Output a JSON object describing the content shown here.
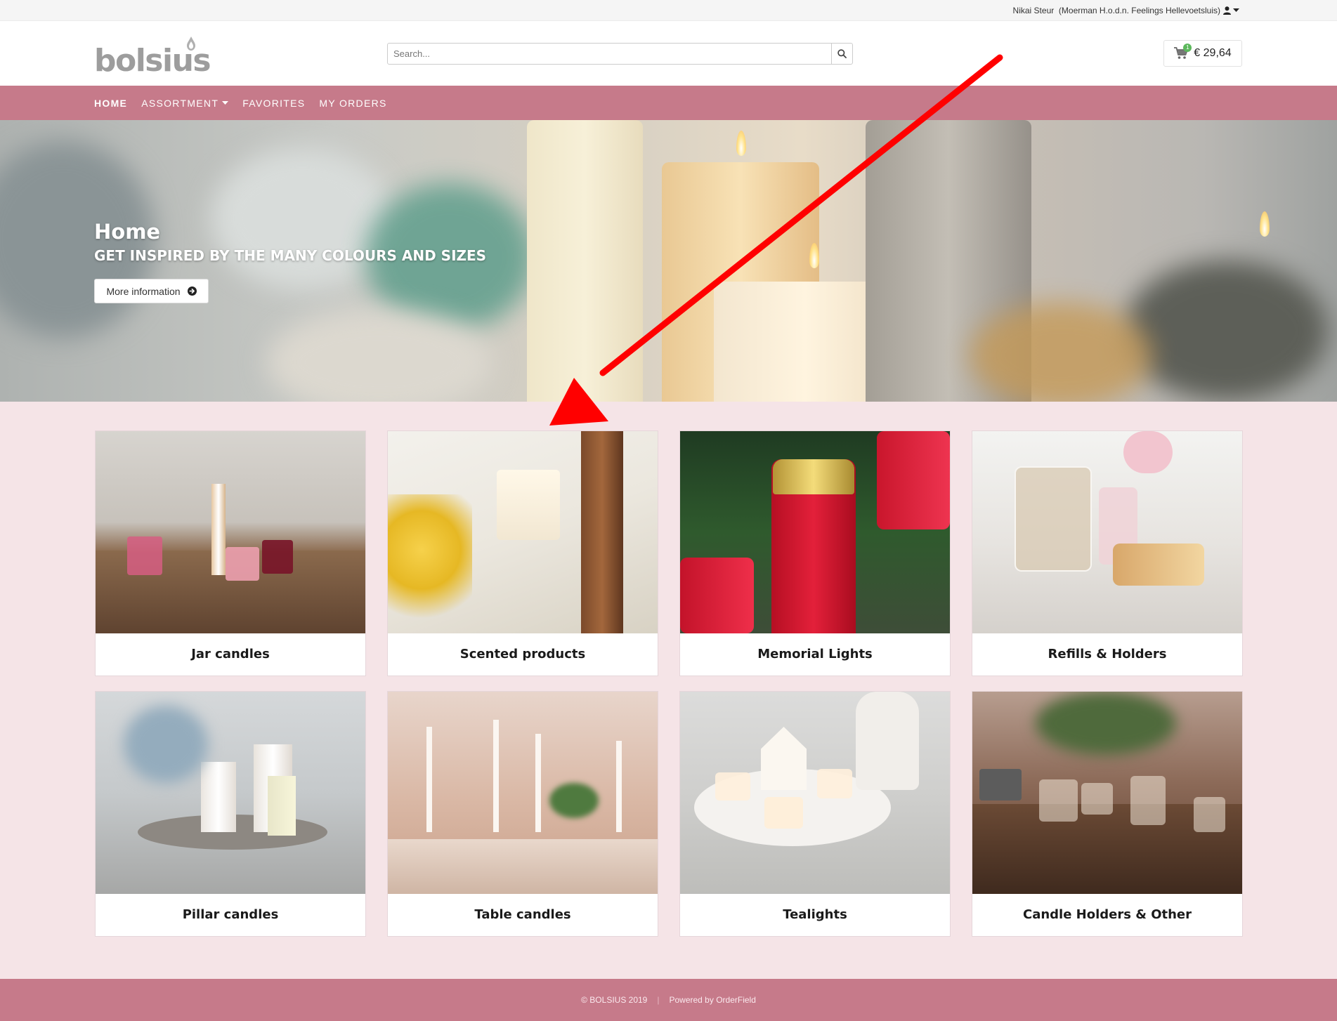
{
  "topbar": {
    "user_name": "Nikai Steur",
    "user_company": "(Moerman H.o.d.n. Feelings Hellevoetsluis)",
    "user_icon": "user-icon"
  },
  "header": {
    "logo_text": "bolsius",
    "search_placeholder": "Search...",
    "cart_count": "1",
    "cart_total": "€ 29,64"
  },
  "nav": {
    "items": [
      {
        "label": "Home",
        "active": true
      },
      {
        "label": "Assortment",
        "dropdown": true
      },
      {
        "label": "Favorites"
      },
      {
        "label": "My orders"
      }
    ]
  },
  "hero": {
    "title": "Home",
    "subtitle": "GET INSPIRED BY THE MANY COLOURS AND SIZES",
    "button_label": "More information"
  },
  "categories": [
    {
      "label": "Jar candles"
    },
    {
      "label": "Scented products"
    },
    {
      "label": "Memorial Lights"
    },
    {
      "label": "Refills & Holders"
    },
    {
      "label": "Pillar candles"
    },
    {
      "label": "Table candles"
    },
    {
      "label": "Tealights"
    },
    {
      "label": "Candle Holders & Other"
    }
  ],
  "footer": {
    "copyright": "© BOLSIUS 2019",
    "separator": "|",
    "powered_by": "Powered by OrderField"
  },
  "colors": {
    "brand_pink": "#c67a8a",
    "page_background": "#f5e4e7",
    "annotation_arrow": "#ff0000"
  }
}
